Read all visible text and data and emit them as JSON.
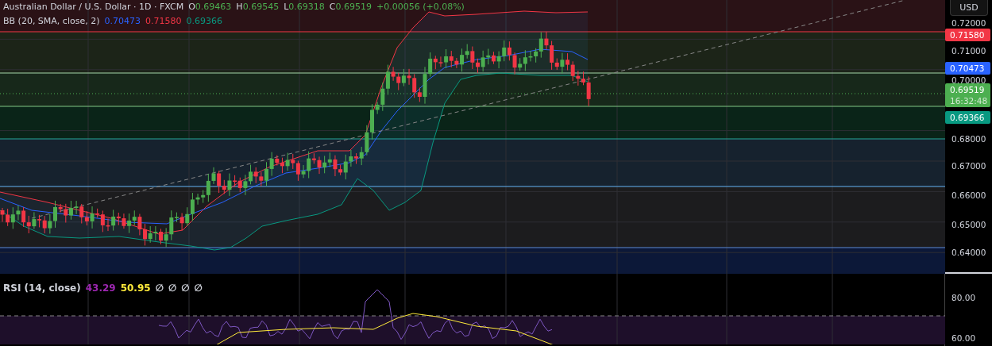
{
  "header": {
    "symbol": "Australian Dollar / U.S. Dollar · 1D · FXCM",
    "ohlc": [
      {
        "label": "O",
        "value": "0.69463"
      },
      {
        "label": "H",
        "value": "0.69545"
      },
      {
        "label": "L",
        "value": "0.69318"
      },
      {
        "label": "C",
        "value": "0.69519"
      }
    ],
    "change": "+0.00056 (+0.08%)"
  },
  "bb_legend": {
    "label": "BB (20, SMA, close, 2)",
    "values": [
      {
        "text": "0.70473",
        "color": "#2962ff"
      },
      {
        "text": "0.71580",
        "color": "#f23645"
      },
      {
        "text": "0.69366",
        "color": "#089981"
      }
    ]
  },
  "currency_button": "USD",
  "price_axis": [
    {
      "kind": "tick",
      "text": "0.72000"
    },
    {
      "kind": "badge",
      "text": "0.71580",
      "color": "#f23645"
    },
    {
      "kind": "tick",
      "text": "0.71000"
    },
    {
      "kind": "badge",
      "text": "0.70473",
      "color": "#2962ff"
    },
    {
      "kind": "tick",
      "text": "0.70000"
    },
    {
      "kind": "badge",
      "text": "0.69519",
      "sub": "16:32:48",
      "color": "#4caf50"
    },
    {
      "kind": "badge",
      "text": "0.69366",
      "color": "#089981"
    },
    {
      "kind": "tick",
      "text": "0.68000"
    },
    {
      "kind": "tick",
      "text": "0.67000"
    },
    {
      "kind": "tick",
      "text": "0.66000"
    },
    {
      "kind": "tick",
      "text": "0.65000"
    },
    {
      "kind": "tick",
      "text": "0.64000"
    }
  ],
  "rsi_legend": {
    "label": "RSI (14, close)",
    "values": [
      {
        "text": "43.29",
        "color": "#9c27b0"
      },
      {
        "text": "50.95",
        "color": "#ffeb3b"
      },
      {
        "text": "∅",
        "color": "#d1d4dc"
      },
      {
        "text": "∅",
        "color": "#d1d4dc"
      },
      {
        "text": "∅",
        "color": "#d1d4dc"
      },
      {
        "text": "∅",
        "color": "#d1d4dc"
      }
    ]
  },
  "rsi_axis": [
    {
      "text": "80.00"
    },
    {
      "text": "60.00"
    }
  ]
}
